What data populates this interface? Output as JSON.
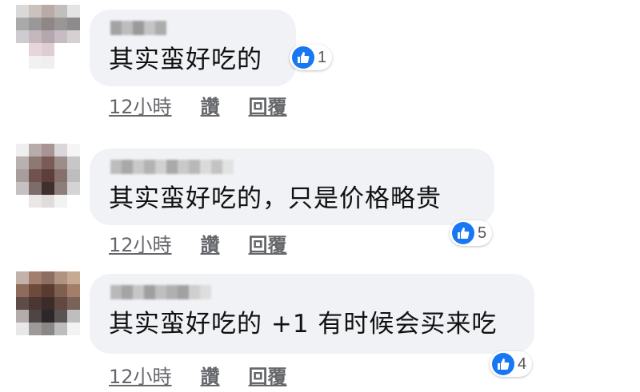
{
  "colors": {
    "bubble_bg": "#f0f2f5",
    "like_blue": "#1877f2",
    "meta_gray": "#65676b"
  },
  "comments": [
    {
      "text": "其实蛮好吃的",
      "reaction": {
        "icon": "thumbs-up-icon",
        "count": "1"
      },
      "time": "12小時",
      "like_label": "讚",
      "reply_label": "回覆"
    },
    {
      "text": "其实蛮好吃的，只是价格略贵",
      "reaction": {
        "icon": "thumbs-up-icon",
        "count": "5"
      },
      "time": "12小時",
      "like_label": "讚",
      "reply_label": "回覆"
    },
    {
      "text": "其实蛮好吃的 +1 有时候会买来吃",
      "reaction": {
        "icon": "thumbs-up-icon",
        "count": "4"
      },
      "time": "12小時",
      "like_label": "讚",
      "reply_label": "回覆"
    }
  ]
}
